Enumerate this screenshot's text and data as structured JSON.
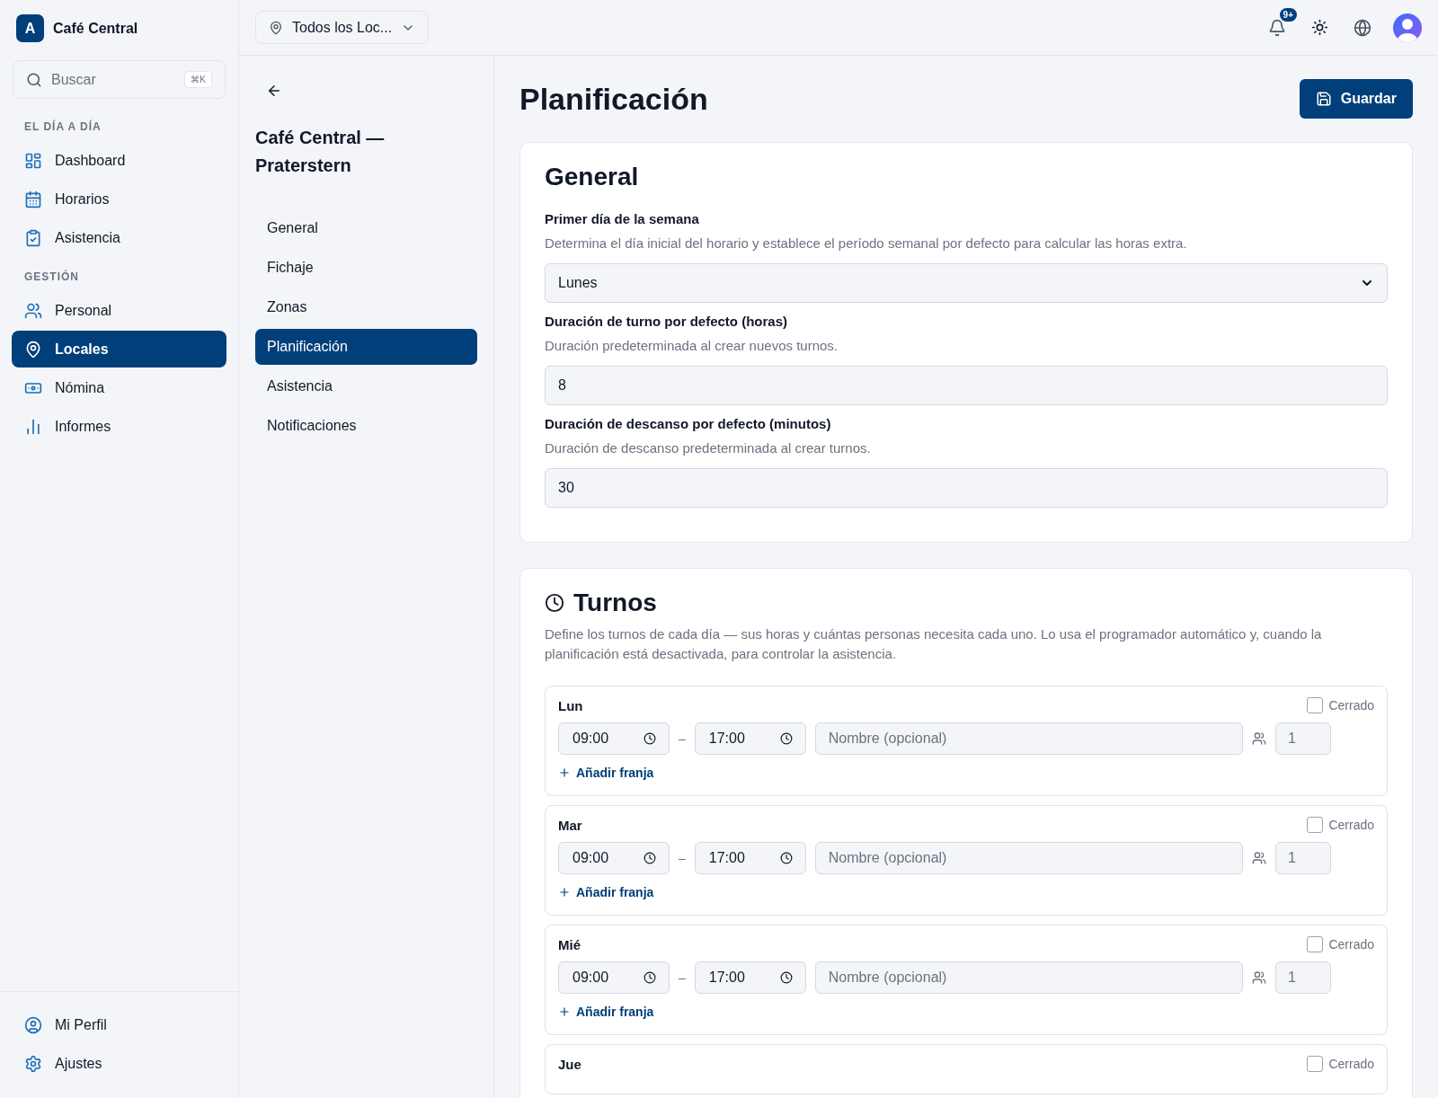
{
  "brand": {
    "logo_letter": "A",
    "name": "Café Central"
  },
  "search": {
    "placeholder": "Buscar",
    "shortcut": "⌘K"
  },
  "sidebar": {
    "sections": [
      {
        "title": "EL DÍA A DÍA",
        "items": [
          {
            "label": "Dashboard",
            "selected": false
          },
          {
            "label": "Horarios",
            "selected": false
          },
          {
            "label": "Asistencia",
            "selected": false
          }
        ]
      },
      {
        "title": "GESTIÓN",
        "items": [
          {
            "label": "Personal",
            "selected": false
          },
          {
            "label": "Locales",
            "selected": true
          },
          {
            "label": "Nómina",
            "selected": false
          },
          {
            "label": "Informes",
            "selected": false
          }
        ]
      }
    ],
    "footer": [
      {
        "label": "Mi Perfil",
        "selected": false
      },
      {
        "label": "Ajustes",
        "selected": false
      }
    ]
  },
  "topbar": {
    "location_selector": "Todos los Loc...",
    "notification_badge": "9+"
  },
  "subnav": {
    "title": "Café Central — Praterstern",
    "items": [
      {
        "label": "General",
        "selected": false
      },
      {
        "label": "Fichaje",
        "selected": false
      },
      {
        "label": "Zonas",
        "selected": false
      },
      {
        "label": "Planificación",
        "selected": true
      },
      {
        "label": "Asistencia",
        "selected": false
      },
      {
        "label": "Notificaciones",
        "selected": false
      }
    ]
  },
  "page": {
    "title": "Planificación",
    "save_button": "Guardar"
  },
  "general": {
    "title": "General",
    "fields": [
      {
        "kind": "select",
        "label": "Primer día de la semana",
        "help": "Determina el día inicial del horario y establece el período semanal por defecto para calcular las horas extra.",
        "value": "Lunes"
      },
      {
        "kind": "input",
        "label": "Duración de turno por defecto (horas)",
        "help": "Duración predeterminada al crear nuevos turnos.",
        "value": "8"
      },
      {
        "kind": "input",
        "label": "Duración de descanso por defecto (minutos)",
        "help": "Duración de descanso predeterminada al crear turnos.",
        "value": "30"
      }
    ]
  },
  "shifts": {
    "title": "Turnos",
    "description": "Define los turnos de cada día — sus horas y cuántas personas necesita cada uno. Lo usa el programador automático y, cuando la planificación está desactivada, para controlar la asistencia.",
    "days": [
      {
        "day": "Lun",
        "closed": false,
        "closed_label": "Cerrado",
        "add_label": "Añadir franja",
        "slots": [
          {
            "start": "09:00",
            "separator": "–",
            "end": "17:00",
            "name_placeholder": "Nombre (opcional)",
            "people": "1"
          }
        ]
      },
      {
        "day": "Mar",
        "closed": false,
        "closed_label": "Cerrado",
        "add_label": "Añadir franja",
        "slots": [
          {
            "start": "09:00",
            "separator": "–",
            "end": "17:00",
            "name_placeholder": "Nombre (opcional)",
            "people": "1"
          }
        ]
      },
      {
        "day": "Mié",
        "closed": false,
        "closed_label": "Cerrado",
        "add_label": "Añadir franja",
        "slots": [
          {
            "start": "09:00",
            "separator": "–",
            "end": "17:00",
            "name_placeholder": "Nombre (opcional)",
            "people": "1"
          }
        ]
      },
      {
        "day": "Jue",
        "closed": false,
        "closed_label": "Cerrado"
      }
    ]
  }
}
